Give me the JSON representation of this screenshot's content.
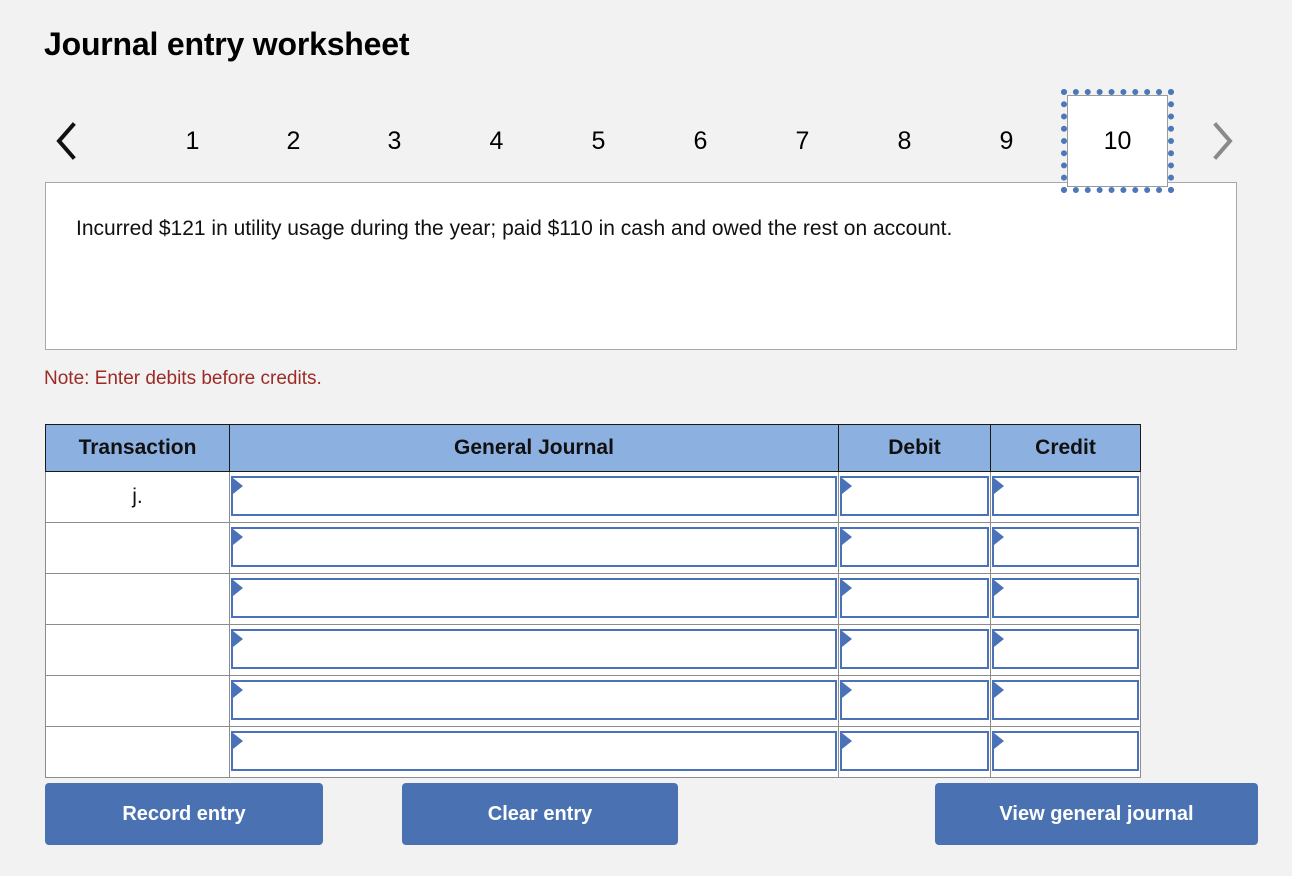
{
  "page": {
    "title": "Journal entry worksheet",
    "background_color": "#f2f2f2"
  },
  "pager": {
    "prev_icon": "chevron-left-icon",
    "next_icon": "chevron-right-icon",
    "prev_enabled": true,
    "next_enabled": false,
    "tabs": [
      "1",
      "2",
      "3",
      "4",
      "5",
      "6",
      "7",
      "8",
      "9",
      "10"
    ],
    "selected_tab": "10",
    "selected_border_color": "#4a78b8"
  },
  "prompt": {
    "text": "Incurred $121 in utility usage during the year; paid $110 in cash and owed the rest on account."
  },
  "note": {
    "text": "Note: Enter debits before credits.",
    "color": "#9c2b26"
  },
  "table": {
    "header_color": "#8cb0e0",
    "columns": [
      "Transaction",
      "General Journal",
      "Debit",
      "Credit"
    ],
    "rows": [
      {
        "transaction": "j.",
        "general_journal": "",
        "debit": "",
        "credit": ""
      },
      {
        "transaction": "",
        "general_journal": "",
        "debit": "",
        "credit": ""
      },
      {
        "transaction": "",
        "general_journal": "",
        "debit": "",
        "credit": ""
      },
      {
        "transaction": "",
        "general_journal": "",
        "debit": "",
        "credit": ""
      },
      {
        "transaction": "",
        "general_journal": "",
        "debit": "",
        "credit": ""
      },
      {
        "transaction": "",
        "general_journal": "",
        "debit": "",
        "credit": ""
      }
    ]
  },
  "buttons": {
    "record": "Record entry",
    "clear": "Clear entry",
    "view": "View general journal",
    "color": "#4a72b3"
  }
}
